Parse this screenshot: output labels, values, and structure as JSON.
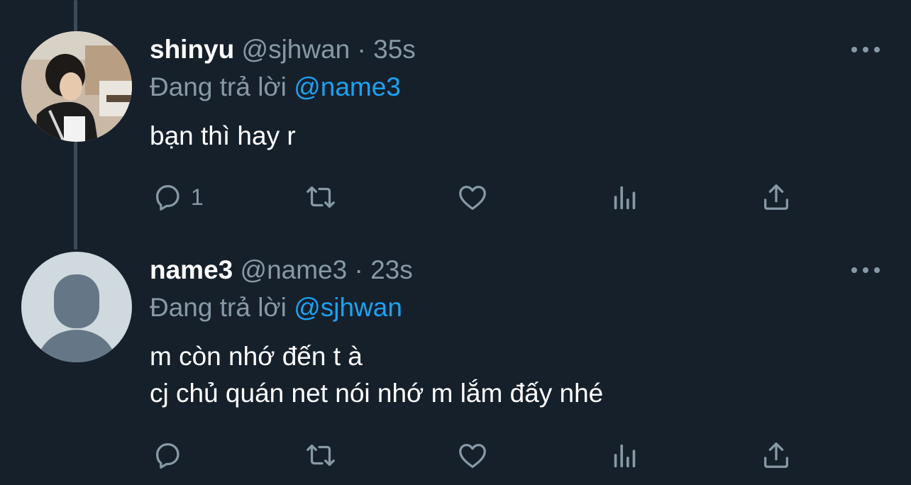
{
  "tweets": [
    {
      "display_name": "shinyu",
      "handle": "@sjhwan",
      "separator": "·",
      "time": "35s",
      "reply_prefix": "Đang trả lời",
      "reply_to": "@name3",
      "body_lines": [
        "bạn thì hay r"
      ],
      "reply_count": "1",
      "avatar": "photo-avatar"
    },
    {
      "display_name": "name3",
      "handle": "@name3",
      "separator": "·",
      "time": "23s",
      "reply_prefix": "Đang trả lời",
      "reply_to": "@sjhwan",
      "body_lines": [
        "m còn nhớ đến t à",
        "cj chủ quán net nói nhớ m lắm đấy nhé"
      ],
      "reply_count": "",
      "avatar": "default-avatar"
    }
  ],
  "colors": {
    "background": "#15202b",
    "text": "#ffffff",
    "muted": "#8899a6",
    "accent": "#1da1f2",
    "thread_line": "#3d4a57"
  }
}
